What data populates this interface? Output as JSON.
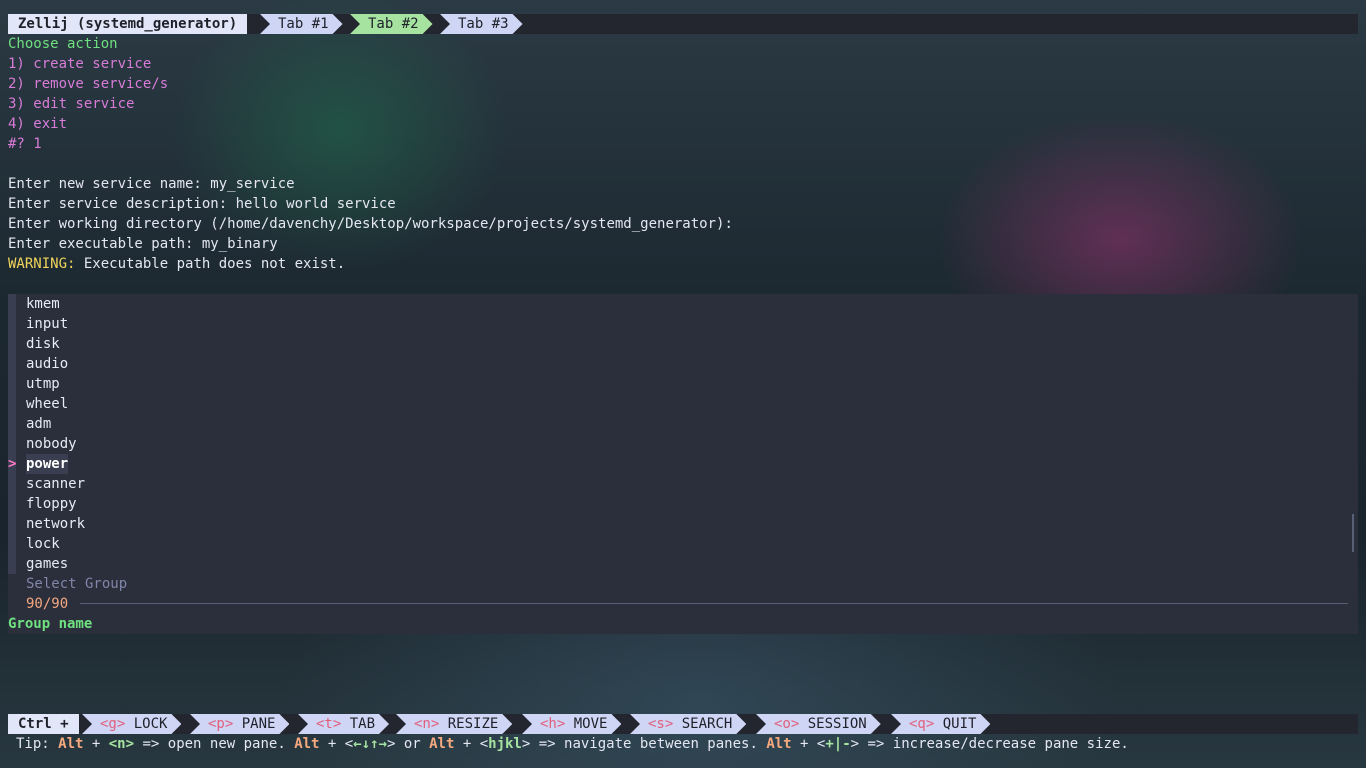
{
  "tabbar": {
    "session_title": "Zellij (systemd_generator)",
    "tabs": [
      {
        "label": "Tab #1",
        "active": false
      },
      {
        "label": "Tab #2",
        "active": true
      },
      {
        "label": "Tab #3",
        "active": false
      }
    ]
  },
  "terminal": {
    "choose_action": "Choose action",
    "options": [
      "1) create service",
      "2) remove service/s",
      "3) edit service",
      "4) exit"
    ],
    "choice_prompt": "#? 1",
    "lines": [
      "Enter new service name: my_service",
      "Enter service description: hello world service",
      "Enter working directory (/home/davenchy/Desktop/workspace/projects/systemd_generator):",
      "Enter executable path: my_binary"
    ],
    "warning_label": "WARNING:",
    "warning_text": " Executable path does not exist."
  },
  "picker": {
    "items": [
      "kmem",
      "input",
      "disk",
      "audio",
      "utmp",
      "wheel",
      "adm",
      "nobody",
      "power",
      "scanner",
      "floppy",
      "network",
      "lock",
      "games"
    ],
    "selected_index": 8,
    "pointer": ">",
    "prompt": "Select Group",
    "count": "90/90",
    "header": "Group name"
  },
  "statusbar": {
    "ctrl_label": "Ctrl +",
    "keys": [
      {
        "key": "<g>",
        "label": "LOCK"
      },
      {
        "key": "<p>",
        "label": "PANE"
      },
      {
        "key": "<t>",
        "label": "TAB"
      },
      {
        "key": "<n>",
        "label": "RESIZE"
      },
      {
        "key": "<h>",
        "label": "MOVE"
      },
      {
        "key": "<s>",
        "label": "SEARCH"
      },
      {
        "key": "<o>",
        "label": "SESSION"
      },
      {
        "key": "<q>",
        "label": "QUIT"
      }
    ]
  },
  "tip": {
    "prefix": "Tip: ",
    "alt": "Alt",
    "plus": " + ",
    "n_key": "<n>",
    "text1": " => open new pane. ",
    "arrows_open": "<",
    "arrows": "←↓↑→",
    "arrows_close": ">",
    "or": " or ",
    "hjkl_open": "<",
    "hjkl": "hjkl",
    "hjkl_close": ">",
    "text2": " => navigate between panes. ",
    "resize_open": "<",
    "resize": "+|-",
    "resize_close": ">",
    "text3": " => increase/decrease pane size."
  }
}
